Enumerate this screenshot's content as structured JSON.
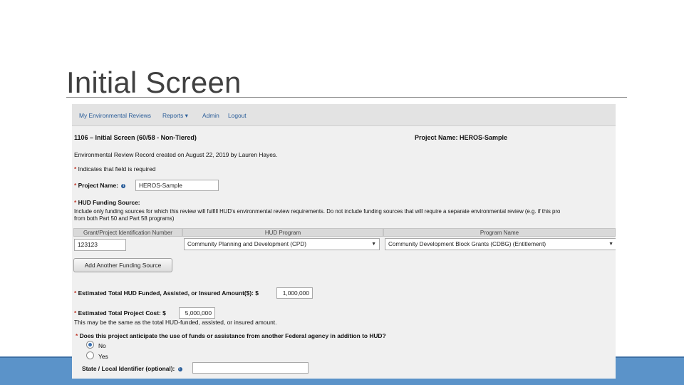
{
  "slide": {
    "title": "Initial Screen"
  },
  "nav": {
    "items": [
      {
        "label": "My Environmental Reviews"
      },
      {
        "label": "Reports ▾"
      },
      {
        "label": "Admin"
      },
      {
        "label": "Logout"
      }
    ]
  },
  "header": {
    "form_title": "1106 – Initial Screen (60/58 - Non-Tiered)",
    "project_label": "Project Name: HEROS-Sample"
  },
  "record_note": "Environmental Review Record created on August 22, 2019 by Lauren Hayes.",
  "required_note": "Indicates that field is required",
  "required_marker": "*",
  "project_name": {
    "label": "Project Name:",
    "value": "HEROS-Sample"
  },
  "funding": {
    "label": "HUD Funding Source:",
    "help_line1": "Include only funding sources for which this review will fulfill HUD's environmental review requirements. Do not include funding sources that will require a separate environmental review (e.g. if this pro",
    "help_line2": "from both Part 50 and Part 58 programs)",
    "columns": [
      "Grant/Project Identification Number",
      "HUD Program",
      "Program Name"
    ],
    "row": {
      "grant_id": "123123",
      "hud_program": "Community Planning and Development (CPD)",
      "program_name": "Community Development Block Grants (CDBG) (Entitlement)"
    },
    "add_button": "Add Another Funding Source"
  },
  "hud_amount": {
    "label": "Estimated Total HUD Funded, Assisted, or Insured Amount($): $",
    "value": "1,000,000"
  },
  "project_cost": {
    "label": "Estimated Total Project Cost: $",
    "value": "5,000,000",
    "note": "This may be the same as the total HUD-funded, assisted, or insured amount."
  },
  "federal_question": {
    "label": "Does this project anticipate the use of funds or assistance from another Federal agency in addition to HUD?",
    "options": [
      {
        "label": "No",
        "selected": true
      },
      {
        "label": "Yes",
        "selected": false
      }
    ]
  },
  "state_id": {
    "label": "State / Local Identifier (optional):",
    "value": ""
  },
  "colors": {
    "link": "#2a5d99",
    "required": "#c0392b",
    "band": "#5b93c9"
  }
}
